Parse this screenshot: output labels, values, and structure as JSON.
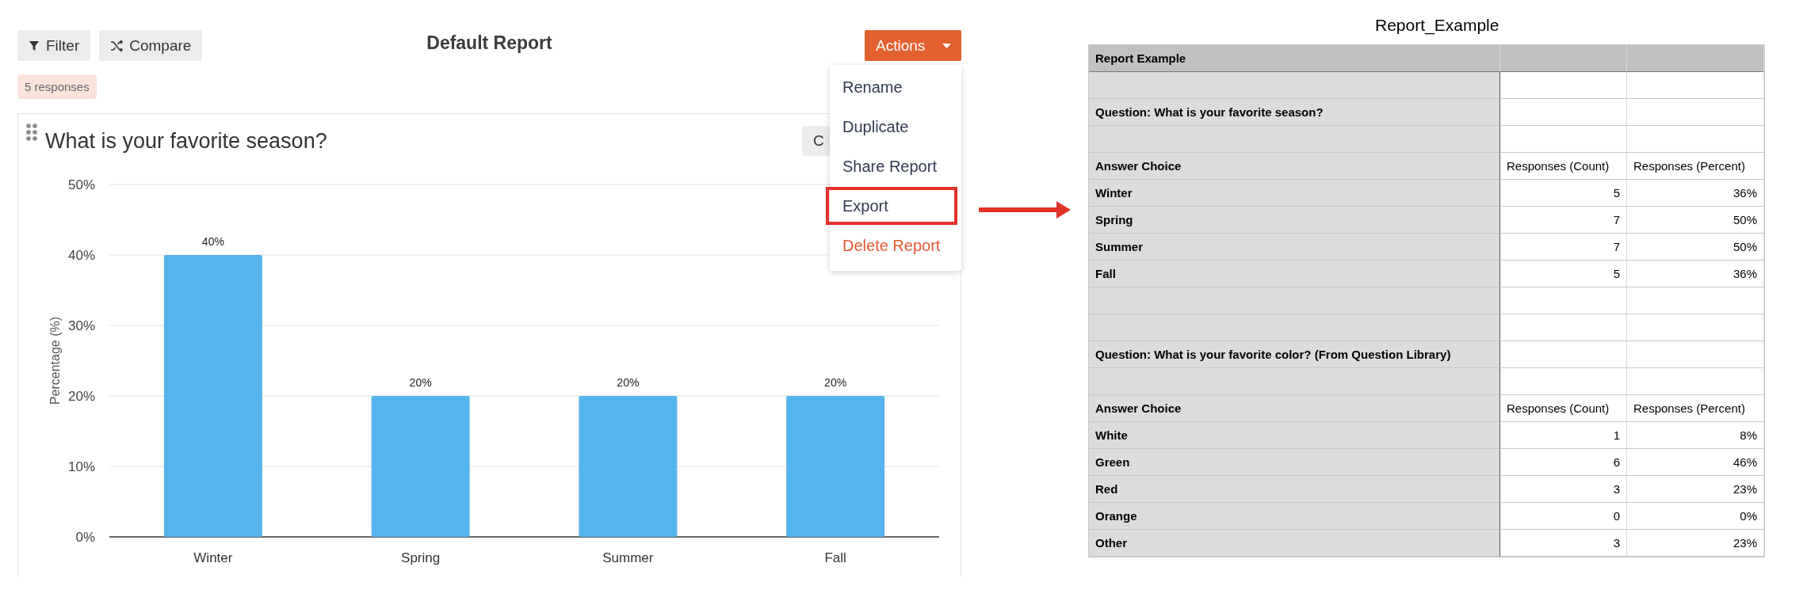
{
  "report_view": {
    "toolbar": {
      "buttons": [
        {
          "kind": "filter",
          "label": "Filter"
        },
        {
          "kind": "compare",
          "label": "Compare"
        }
      ],
      "title": "Default Report",
      "actions_button": "Actions"
    },
    "actions_menu": {
      "items": [
        {
          "label": "Rename",
          "kind": "normal",
          "highlighted": false
        },
        {
          "label": "Duplicate",
          "kind": "normal",
          "highlighted": false
        },
        {
          "label": "Share Report",
          "kind": "normal",
          "highlighted": false
        },
        {
          "label": "Export",
          "kind": "normal",
          "highlighted": true
        },
        {
          "label": "Delete Report",
          "kind": "danger",
          "highlighted": false
        }
      ]
    },
    "response_badge": "5 responses",
    "card": {
      "title": "What is your favorite season?",
      "button": "C",
      "chart_data": {
        "type": "bar",
        "ylabel": "Percentage (%)",
        "categories": [
          "Winter",
          "Spring",
          "Summer",
          "Fall"
        ],
        "values": [
          40,
          20,
          20,
          20
        ],
        "grid": true,
        "ylim": [
          0,
          50
        ],
        "yticks": [
          {
            "value": 0,
            "label": "0%"
          },
          {
            "value": 10,
            "label": "10%"
          },
          {
            "value": 20,
            "label": "20%"
          },
          {
            "value": 30,
            "label": "30%"
          },
          {
            "value": 40,
            "label": "40%"
          },
          {
            "value": 50,
            "label": "50%"
          }
        ],
        "value_labels": [
          "40%",
          "20%",
          "20%",
          "20%"
        ]
      }
    }
  },
  "spreadsheet": {
    "title": "Report_Example",
    "rows": [
      {
        "kind": "title",
        "label": "Report Example"
      },
      {
        "kind": "blank"
      },
      {
        "kind": "question",
        "label": "Question: What is your favorite season?"
      },
      {
        "kind": "blank"
      },
      {
        "kind": "header",
        "label": "Answer Choice",
        "count": "Responses (Count)",
        "percent": "Responses (Percent)"
      },
      {
        "kind": "data",
        "label": "Winter",
        "count": "5",
        "percent": "36%"
      },
      {
        "kind": "data",
        "label": "Spring",
        "count": "7",
        "percent": "50%"
      },
      {
        "kind": "data",
        "label": "Summer",
        "count": "7",
        "percent": "50%"
      },
      {
        "kind": "data",
        "label": "Fall",
        "count": "5",
        "percent": "36%"
      },
      {
        "kind": "blank"
      },
      {
        "kind": "blank"
      },
      {
        "kind": "question",
        "label": "Question: What is your favorite color? (From Question Library)"
      },
      {
        "kind": "blank"
      },
      {
        "kind": "header",
        "label": "Answer Choice",
        "count": "Responses (Count)",
        "percent": "Responses (Percent)"
      },
      {
        "kind": "data",
        "label": "White",
        "count": "1",
        "percent": "8%"
      },
      {
        "kind": "data",
        "label": "Green",
        "count": "6",
        "percent": "46%"
      },
      {
        "kind": "data",
        "label": "Red",
        "count": "3",
        "percent": "23%"
      },
      {
        "kind": "data",
        "label": "Orange",
        "count": "0",
        "percent": "0%"
      },
      {
        "kind": "data",
        "label": "Other",
        "count": "3",
        "percent": "23%"
      }
    ]
  }
}
